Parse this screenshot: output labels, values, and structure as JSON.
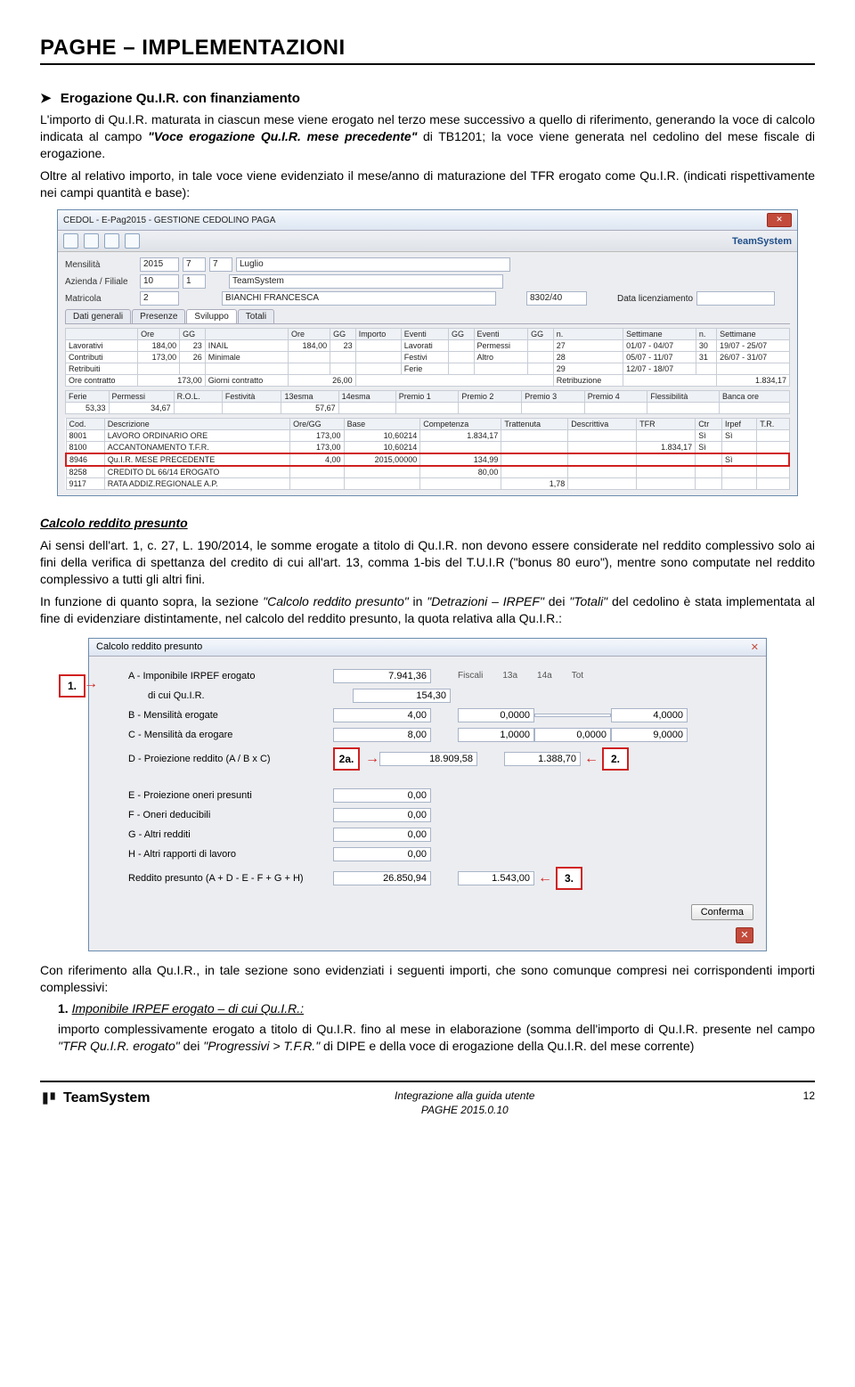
{
  "header": "PAGHE – IMPLEMENTAZIONI",
  "sec": {
    "arrow": "➤",
    "title": "Erogazione Qu.I.R. con finanziamento",
    "p1a": "L'importo di Qu.I.R. maturata in ciascun mese viene erogato nel terzo mese successivo a quello di riferimento, generando la voce di calcolo indicata al campo ",
    "p1b": "\"Voce erogazione Qu.I.R. mese precedente\"",
    "p1c": " di TB1201; la voce viene generata nel cedolino del mese fiscale di erogazione.",
    "p2": "Oltre al relativo importo, in tale voce viene evidenziato il mese/anno di maturazione del TFR erogato come Qu.I.R. (indicati rispettivamente nei campi quantità e base):"
  },
  "win1": {
    "title": "CEDOL - E-Pag2015 - GESTIONE CEDOLINO PAGA",
    "teams": "TeamSystem",
    "labels": {
      "mensilita": "Mensilità",
      "az": "Azienda / Filiale",
      "mat": "Matricola",
      "dataLic": "Data licenziamento"
    },
    "values": {
      "anno": "2015",
      "mese_n": "7",
      "mese_v": "7",
      "mese_txt": "Luglio",
      "az_n": "10",
      "az_f": "1",
      "az_txt": "TeamSystem",
      "mat_n": "2",
      "mat_txt": "BIANCHI FRANCESCA",
      "codfisc": "8302/40"
    },
    "tabs": [
      "Dati generali",
      "Presenze",
      "Sviluppo",
      "Totali"
    ],
    "grid1": {
      "h": [
        "",
        "Ore",
        "GG",
        "",
        "Ore",
        "GG",
        "Importo",
        "Eventi",
        "GG",
        "Eventi",
        "GG",
        "n.",
        "Settimane",
        "n.",
        "Settimane"
      ],
      "r1": [
        "Lavorativi",
        "184,00",
        "23",
        "INAIL",
        "184,00",
        "23",
        "",
        "Lavorati",
        "",
        "Permessi",
        "",
        "27",
        "01/07 - 04/07",
        "30",
        "19/07 - 25/07"
      ],
      "r2": [
        "Contributi",
        "173,00",
        "26",
        "Minimale",
        "",
        "",
        "",
        "Festivi",
        "",
        "Altro",
        "",
        "28",
        "05/07 - 11/07",
        "31",
        "26/07 - 31/07"
      ],
      "r3": [
        "Retribuiti",
        "",
        "",
        "",
        "",
        "",
        "",
        "Ferie",
        "",
        "",
        "",
        "29",
        "12/07 - 18/07",
        "",
        ""
      ],
      "r4": [
        "Ore contratto",
        "173,00",
        "",
        "Giorni contratto",
        "26,00",
        "",
        "",
        "",
        "",
        "",
        "",
        "Retribuzione",
        "",
        "",
        "1.834,17"
      ]
    },
    "grid2": {
      "h": [
        "Ferie",
        "Permessi",
        "R.O.L.",
        "Festività",
        "13esma",
        "14esma",
        "Premio 1",
        "Premio 2",
        "Premio 3",
        "Premio 4",
        "Flessibilità",
        "Banca ore"
      ],
      "r": [
        "53,33",
        "34,67",
        "",
        "",
        "57,67",
        "",
        "",
        "",
        "",
        "",
        "",
        ""
      ]
    },
    "grid3": {
      "h": [
        "Cod.",
        "Descrizione",
        "Ore/GG",
        "Base",
        "Competenza",
        "Trattenuta",
        "Descrittiva",
        "TFR",
        "Ctr",
        "Irpef",
        "T.R."
      ],
      "rows": [
        [
          "8001",
          "LAVORO ORDINARIO ORE",
          "173,00",
          "10,60214",
          "1.834,17",
          "",
          "",
          "",
          "Sì",
          "Sì",
          ""
        ],
        [
          "8100",
          "ACCANTONAMENTO T.F.R.",
          "173,00",
          "10,60214",
          "",
          "",
          "",
          "1.834,17",
          "Sì",
          "",
          ""
        ],
        [
          "8946",
          "Qu.I.R. MESE PRECEDENTE",
          "4,00",
          "2015,00000",
          "134,99",
          "",
          "",
          "",
          "",
          "Sì",
          ""
        ],
        [
          "8258",
          "CREDITO DL 66/14 EROGATO",
          "",
          "",
          "80,00",
          "",
          "",
          "",
          "",
          "",
          ""
        ],
        [
          "9117",
          "RATA ADDIZ.REGIONALE A.P.",
          "",
          "",
          "",
          "1,78",
          "",
          "",
          "",
          "",
          ""
        ]
      ]
    }
  },
  "calc": {
    "heading": "Calcolo reddito presunto",
    "p1_a": "Ai sensi dell'art. 1, c. 27, L. 190/2014, le somme erogate a titolo di Qu.I.R. non devono essere considerate nel reddito complessivo solo ai fini della verifica di spettanza del credito di cui all'art. 13, comma 1-bis del T.U.I.R (\"bonus 80 euro\"), mentre sono computate nel reddito complessivo a tutti gli altri fini.",
    "p2_a": "In funzione di quanto sopra, la sezione ",
    "p2_b": "\"Calcolo reddito presunto\"",
    "p2_c": " in ",
    "p2_d": "\"Detrazioni – IRPEF\"",
    "p2_e": " dei ",
    "p2_f": "\"Totali\"",
    "p2_g": " del cedolino è stata implementata al fine di evidenziare distintamente, nel calcolo del reddito presunto, la quota relativa alla Qu.I.R.:"
  },
  "win2": {
    "title": "Calcolo reddito presunto",
    "cols": [
      "Fiscali",
      "13a",
      "14a",
      "Tot"
    ],
    "rows": {
      "A": {
        "k": "A - Imponibile IRPEF erogato",
        "v": "7.941,36"
      },
      "A1": {
        "k": "di cui Qu.I.R.",
        "v": "154,30"
      },
      "B": {
        "k": "B - Mensilità erogate",
        "v": [
          "4,00",
          "0,0000",
          "",
          "4,0000"
        ]
      },
      "C": {
        "k": "C - Mensilità da erogare",
        "v": [
          "8,00",
          "1,0000",
          "0,0000",
          "9,0000"
        ]
      },
      "D": {
        "k": "D - Proiezione reddito (A / B x C)",
        "v": [
          "18.909,58",
          "1.388,70"
        ]
      },
      "E": {
        "k": "E - Proiezione oneri presunti",
        "v": "0,00"
      },
      "F": {
        "k": "F - Oneri deducibili",
        "v": "0,00"
      },
      "G": {
        "k": "G - Altri redditi",
        "v": "0,00"
      },
      "H": {
        "k": "H - Altri rapporti di lavoro",
        "v": "0,00"
      },
      "R": {
        "k": "Reddito presunto (A + D - E - F + G + H)",
        "v": [
          "26.850,94",
          "1.543,00"
        ]
      }
    },
    "callouts": {
      "c1": "1.",
      "c2a": "2a.",
      "c2": "2.",
      "c3": "3."
    },
    "conferma": "Conferma"
  },
  "after": {
    "p1": "Con riferimento alla Qu.I.R., in tale sezione sono evidenziati i seguenti importi, che sono comunque compresi nei corrispondenti importi complessivi:",
    "li_num": "1.",
    "li_label": "Imponibile IRPEF erogato – di cui Qu.I.R.:",
    "li_txt_a": "importo complessivamente erogato a titolo di Qu.I.R. fino al mese in elaborazione (somma dell'importo di Qu.I.R. presente nel campo ",
    "li_txt_b": "\"TFR Qu.I.R. erogato\"",
    "li_txt_c": " dei ",
    "li_txt_d": "\"Progressivi > T.F.R.\"",
    "li_txt_e": " di DIPE e della voce di erogazione della Qu.I.R. del mese corrente)"
  },
  "footer": {
    "logo": "TeamSystem",
    "c1": "Integrazione alla guida utente",
    "c2": "PAGHE 2015.0.10",
    "page": "12"
  }
}
